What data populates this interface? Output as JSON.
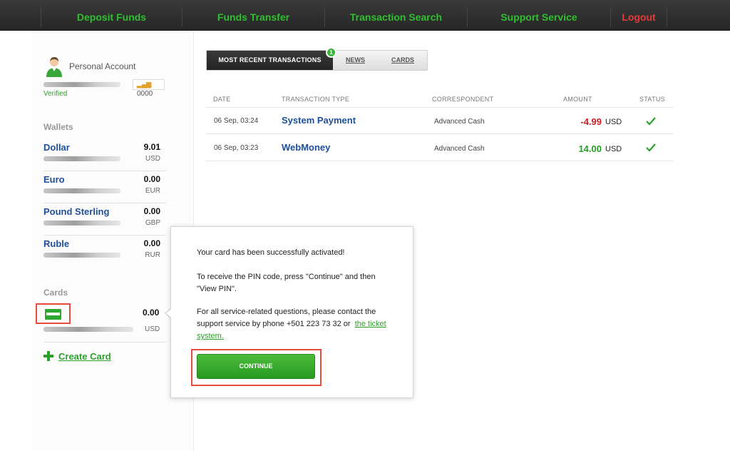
{
  "nav": {
    "items": [
      "Deposit Funds",
      "Funds Transfer",
      "Transaction Search",
      "Support Service"
    ],
    "logout": "Logout"
  },
  "account": {
    "title": "Personal Account",
    "status": "Verified",
    "badge": "0000"
  },
  "wallets": {
    "title": "Wallets",
    "items": [
      {
        "name": "Dollar",
        "amount": "9.01",
        "currency": "USD"
      },
      {
        "name": "Euro",
        "amount": "0.00",
        "currency": "EUR"
      },
      {
        "name": "Pound Sterling",
        "amount": "0.00",
        "currency": "GBP"
      },
      {
        "name": "Ruble",
        "amount": "0.00",
        "currency": "RUR"
      }
    ]
  },
  "cards": {
    "title": "Cards",
    "amount": "0.00",
    "currency": "USD",
    "create_label": "Create Card"
  },
  "tabs": {
    "active": "MOST RECENT TRANSACTIONS",
    "news": "NEWS",
    "cards": "CARDS",
    "notification_count": "1"
  },
  "table": {
    "headers": [
      "DATE",
      "TRANSACTION TYPE",
      "CORRESPONDENT",
      "AMOUNT",
      "STATUS"
    ],
    "rows": [
      {
        "date": "06 Sep, 03:24",
        "type": "System Payment",
        "correspondent": "Advanced Cash",
        "amount": "-4.99",
        "currency": "USD",
        "amount_color": "#cc1f1f"
      },
      {
        "date": "06 Sep, 03:23",
        "type": "WebMoney",
        "correspondent": "Advanced Cash",
        "amount": "14.00",
        "currency": "USD",
        "amount_color": "#22a022"
      }
    ]
  },
  "popup": {
    "line1": "Your card has been successfully activated!",
    "line2": "To receive the PIN code, press \"Continue\" and then \"View PIN\".",
    "line3": "For all service-related questions, please contact the support service by phone +501 223 73 32 or",
    "link": "the ticket system.",
    "button": "CONTINUE"
  }
}
